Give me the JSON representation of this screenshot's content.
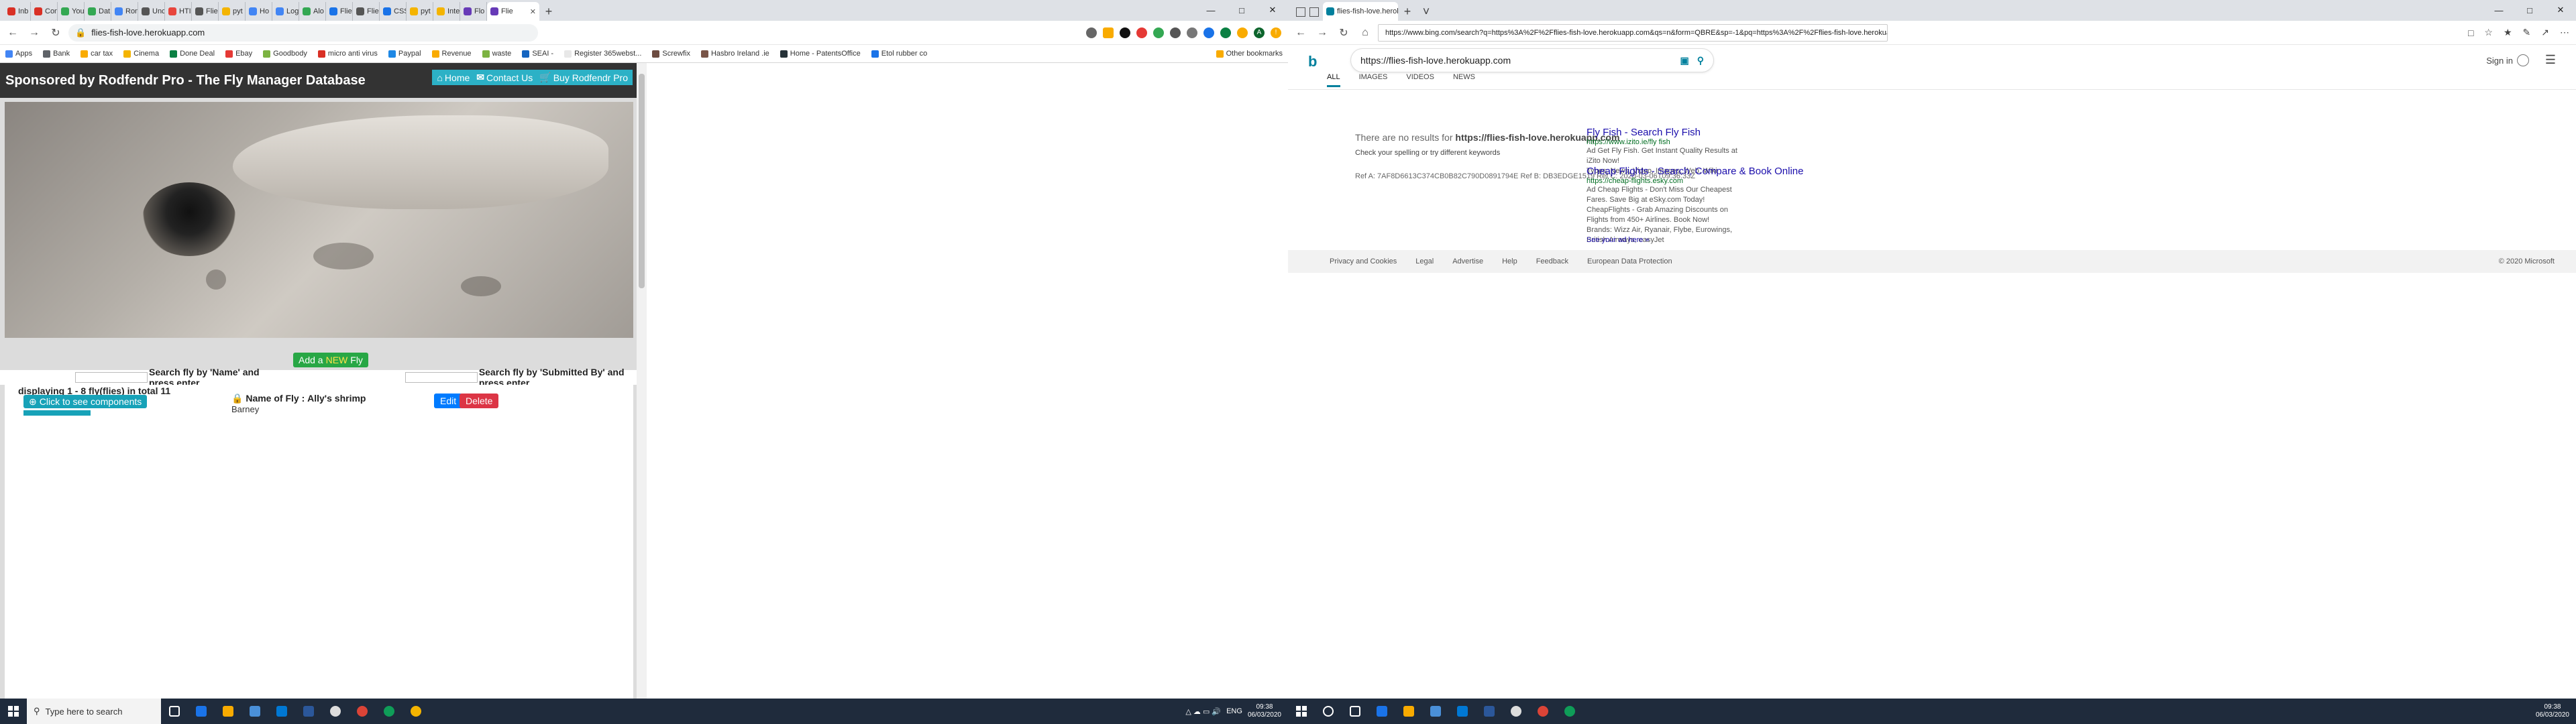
{
  "left_browser": {
    "tabs": [
      {
        "label": "Inb",
        "color": "#d93025"
      },
      {
        "label": "Con",
        "color": "#d93025"
      },
      {
        "label": "You",
        "color": "#34a853"
      },
      {
        "label": "Dat",
        "color": "#34a853"
      },
      {
        "label": "Ron",
        "color": "#4285f4"
      },
      {
        "label": "Unc",
        "color": "#555555"
      },
      {
        "label": "HTI",
        "color": "#e8453c"
      },
      {
        "label": "Flie",
        "color": "#555555"
      },
      {
        "label": "pyt",
        "color": "#f4b400"
      },
      {
        "label": "Ho",
        "color": "#4285f4"
      },
      {
        "label": "Log",
        "color": "#4285f4"
      },
      {
        "label": "Alo",
        "color": "#34a853"
      },
      {
        "label": "Flie",
        "color": "#1a73e8"
      },
      {
        "label": "Flie",
        "color": "#555555"
      },
      {
        "label": "CSS",
        "color": "#1a73e8"
      },
      {
        "label": "pyt",
        "color": "#f4b400"
      },
      {
        "label": "Inte",
        "color": "#f4b400"
      },
      {
        "label": "Flo",
        "color": "#673ab7"
      },
      {
        "label": "Flie",
        "color": "#673ab7"
      }
    ],
    "active_tab": "Flie",
    "url": "flies-fish-love.herokuapp.com",
    "bookmarks": [
      "Apps",
      "Bank",
      "car tax",
      "Cinema",
      "Done Deal",
      "Ebay",
      "Goodbody",
      "micro anti virus",
      "Paypal",
      "Revenue",
      "waste",
      "SEAI -",
      "Register 365webst...",
      "Screwfix",
      "Hasbro Ireland .ie",
      "Home - PatentsOffice",
      "Etol rubber co"
    ],
    "other_bookmarks": "Other bookmarks",
    "site": {
      "title": "Sponsored by Rodfendr Pro - The Fly Manager Database",
      "nav": {
        "home": "Home",
        "contact": "Contact Us",
        "buy": "Buy Rodfendr Pro"
      },
      "add_button": {
        "prefix": "Add a",
        "highlight": "NEW",
        "suffix": "Fly"
      },
      "search_name_label": "Search fly by 'Name' and press enter",
      "search_submitted_label": "Search fly by 'Submitted By' and press enter",
      "count_text": "displaying 1 - 8 fly(flies) in total 11",
      "components_button": "Click to see components",
      "fly": {
        "name_label": "Name of Fly :",
        "name": "Ally's shrimp",
        "submitted_by": "Barney"
      },
      "edit": "Edit",
      "delete": "Delete"
    }
  },
  "right_browser": {
    "tab_label": "flies-fish-love.herokuapp",
    "url": "https://www.bing.com/search?q=https%3A%2F%2Fflies-fish-love.herokuapp.com&qs=n&form=QBRE&sp=-1&pq=https%3A%2F%2Fflies-fish-love.herokuapp.com&sc=1-37&sk=&cvid=A4715A6154A842CF86BF721C6096F78D",
    "search_query": "https://flies-fish-love.herokuapp.com",
    "sign_in": "Sign in",
    "tabs": [
      "ALL",
      "IMAGES",
      "VIDEOS",
      "NEWS"
    ],
    "no_results_prefix": "There are no results for",
    "no_results_query": "https://flies-fish-love.herokuapp.com",
    "spelling_hint": "Check your spelling or try different keywords",
    "ref_text": "Ref A: 7AF8D6613C374CB0B82C790D0891794E Ref B: DB3EDGE1519 Ref C: 2020-03-06T09:36:33Z",
    "ads": [
      {
        "title": "Fly Fish - Search Fly Fish",
        "url": "https://www.izito.ie/fly fish",
        "desc": "Ad Get Fly Fish. Get Instant Quality Results at iZito Now!",
        "desc2": "Types: News, Video, Images, Web, Wiki"
      },
      {
        "title": "Cheap Flights - Search, Compare & Book Online",
        "url": "https://cheap-flights.esky.com",
        "desc": "Ad Cheap Flights - Don't Miss Our Cheapest Fares. Save Big at eSky.com Today! CheapFlights - Grab Amazing Discounts on Flights from 450+ Airlines. Book Now!",
        "desc2": "Brands: Wizz Air, Ryanair, Flybe, Eurowings, British Airways, easyJet"
      }
    ],
    "see_ad": "See your ad here »",
    "footer": [
      "Privacy and Cookies",
      "Legal",
      "Advertise",
      "Help",
      "Feedback",
      "European Data Protection"
    ],
    "copyright": "© 2020 Microsoft"
  },
  "taskbar": {
    "search_placeholder": "Type here to search",
    "lang": "ENG",
    "time": "09:38",
    "date": "06/03/2020"
  }
}
